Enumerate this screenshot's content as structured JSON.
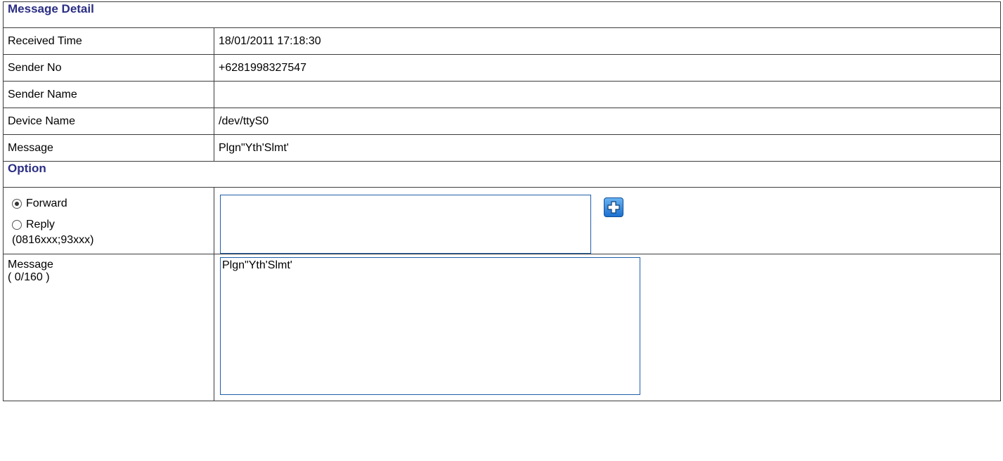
{
  "detail": {
    "title": "Message Detail",
    "rows": [
      {
        "label": "Received Time",
        "value": "18/01/2011 17:18:30"
      },
      {
        "label": "Sender No",
        "value": "+6281998327547"
      },
      {
        "label": "Sender Name",
        "value": ""
      },
      {
        "label": "Device Name",
        "value": "/dev/ttyS0"
      },
      {
        "label": "Message",
        "value": "Plgn\"Yth'Slmt'"
      }
    ]
  },
  "option": {
    "title": "Option",
    "forward_label": "Forward",
    "reply_label": "Reply",
    "recipient_hint": "(0816xxx;93xxx)",
    "selected": "Forward",
    "recipient_value": "",
    "message_label": "Message",
    "message_count": "( 0/160 )",
    "message_value": "Plgn\"Yth'Slmt'"
  },
  "icons": {
    "add": "plus-icon"
  },
  "colors": {
    "header_text": "#2b2e84",
    "input_border": "#1f5fa8",
    "add_button": "#1a6fcf"
  }
}
